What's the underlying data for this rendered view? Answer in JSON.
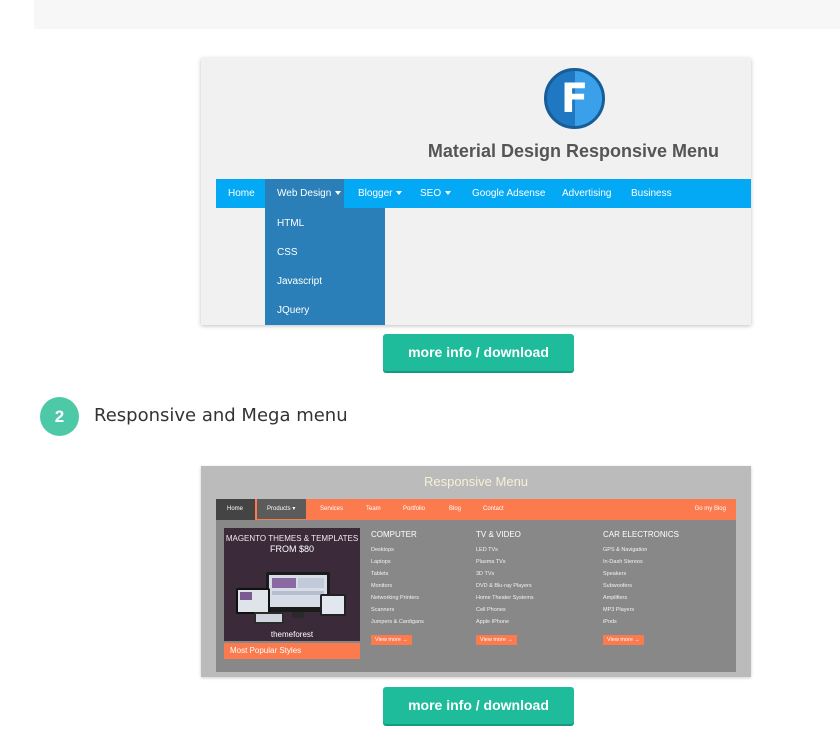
{
  "card1": {
    "logo_letter": "F",
    "title": "Material Design Responsive Menu",
    "nav": [
      {
        "label": "Home"
      },
      {
        "label": "Web Design"
      },
      {
        "label": "Blogger"
      },
      {
        "label": "SEO"
      },
      {
        "label": "Google Adsense"
      },
      {
        "label": "Advertising"
      },
      {
        "label": "Business"
      }
    ],
    "dropdown": [
      "HTML",
      "CSS",
      "Javascript",
      "JQuery"
    ]
  },
  "button_label": "more info / download",
  "section2": {
    "number": "2",
    "title": "Responsive and Mega menu"
  },
  "card2": {
    "title": "Responsive Menu",
    "nav": [
      "Home",
      "Products ▾",
      "Services",
      "Team",
      "Portfolio",
      "Blog",
      "Contact"
    ],
    "nav_right": "Go my Blog",
    "promo": {
      "line1": "MAGENTO THEMES & TEMPLATES",
      "line2": "FROM $80",
      "brand": "themeforest",
      "footer": "Most Popular Styles"
    },
    "columns": [
      {
        "heading": "COMPUTER",
        "items": [
          "Desktops",
          "Laptops",
          "Tablets",
          "Monitors",
          "Networking Printers",
          "Scanners",
          "Jumpers & Cardigans"
        ],
        "more": "View more →"
      },
      {
        "heading": "TV & VIDEO",
        "items": [
          "LED TVs",
          "Plasma TVs",
          "3D TVs",
          "DVD & Blu-ray Players",
          "Home Theater Systems",
          "Cell Phones",
          "Apple IPhone"
        ],
        "more": "View more →"
      },
      {
        "heading": "CAR ELECTRONICS",
        "items": [
          "GPS & Navigation",
          "In-Dash Stereos",
          "Speakers",
          "Subwoofers",
          "Amplifiers",
          "MP3 Players",
          "iPods"
        ],
        "more": "View more →"
      }
    ]
  },
  "colors": {
    "material_blue": "#03a9f4",
    "dropdown_blue": "#2a7fb8",
    "button_teal": "#1fbc9c",
    "badge_teal": "#4dc9a8",
    "mega_orange": "#fb7b4e"
  }
}
